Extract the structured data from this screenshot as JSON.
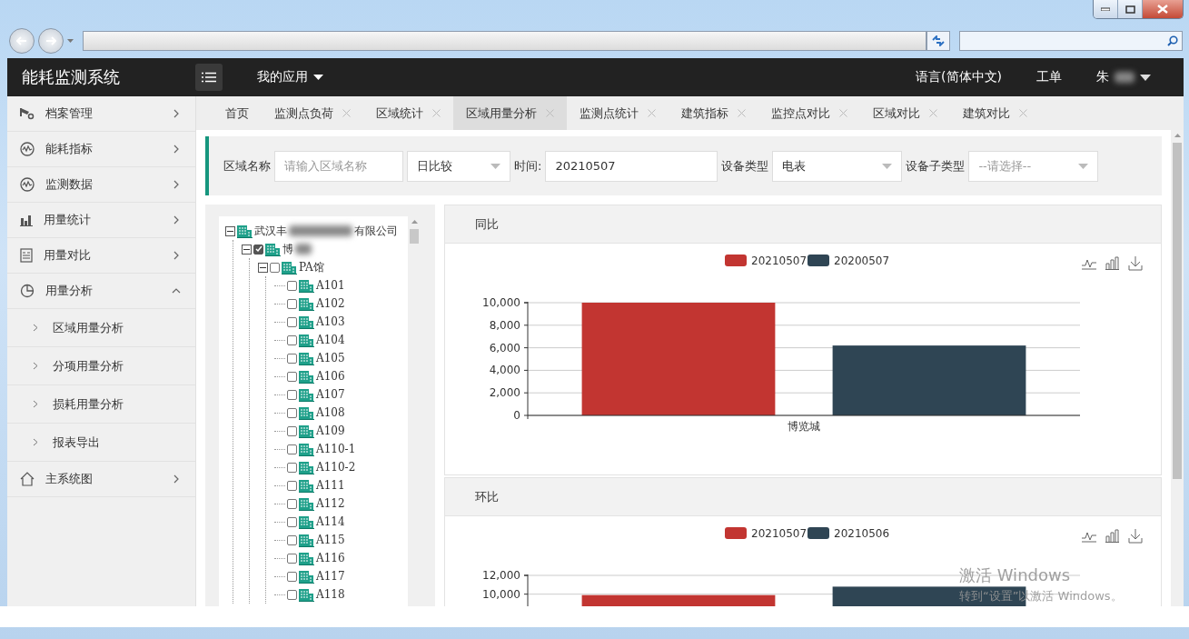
{
  "header": {
    "title": "能耗监测系统",
    "menu": "我的应用",
    "language": "语言(简体中文)",
    "work_order": "工单",
    "user": {
      "name": "朱",
      "redacted": true
    }
  },
  "sidebar": [
    {
      "label": "档案管理",
      "expanded": false
    },
    {
      "label": "能耗指标",
      "expanded": false
    },
    {
      "label": "监测数据",
      "expanded": false
    },
    {
      "label": "用量统计",
      "expanded": false
    },
    {
      "label": "用量对比",
      "expanded": false
    },
    {
      "label": "用量分析",
      "expanded": true,
      "children": [
        "区域用量分析",
        "分项用量分析",
        "损耗用量分析",
        "报表导出"
      ]
    },
    {
      "label": "主系统图",
      "expanded": false
    }
  ],
  "tabs": [
    {
      "label": "首页",
      "selected": false,
      "closable": false
    },
    {
      "label": "监测点负荷",
      "selected": false,
      "closable": true
    },
    {
      "label": "区域统计",
      "selected": false,
      "closable": true
    },
    {
      "label": "区域用量分析",
      "selected": true,
      "closable": true
    },
    {
      "label": "监测点统计",
      "selected": false,
      "closable": true
    },
    {
      "label": "建筑指标",
      "selected": false,
      "closable": true
    },
    {
      "label": "监控点对比",
      "selected": false,
      "closable": true
    },
    {
      "label": "区域对比",
      "selected": false,
      "closable": true
    },
    {
      "label": "建筑对比",
      "selected": false,
      "closable": true
    }
  ],
  "filters": [
    {
      "kind": "label",
      "text": "区域名称"
    },
    {
      "kind": "input",
      "placeholder": "请输入区域名称"
    },
    {
      "kind": "select",
      "value": "日比较"
    },
    {
      "kind": "label",
      "text": "时间:"
    },
    {
      "kind": "input",
      "value": "20210507"
    },
    {
      "kind": "label",
      "text": "设备类型"
    },
    {
      "kind": "select",
      "value": "电表"
    },
    {
      "kind": "label",
      "text": "设备子类型"
    },
    {
      "kind": "select",
      "placeholder": "--请选择--"
    }
  ],
  "tree": {
    "label": "武汉丰",
    "label_end": "有限公司",
    "redacted": true,
    "expanded": true,
    "children": [
      {
        "label": "博",
        "redacted": true,
        "checked": true,
        "expanded": true,
        "children": [
          {
            "label": "PA馆",
            "checked": false,
            "expanded": true,
            "children": [
              {
                "label": "A101",
                "checked": false
              },
              {
                "label": "A102",
                "checked": false
              },
              {
                "label": "A103",
                "checked": false
              },
              {
                "label": "A104",
                "checked": false
              },
              {
                "label": "A105",
                "checked": false
              },
              {
                "label": "A106",
                "checked": false
              },
              {
                "label": "A107",
                "checked": false
              },
              {
                "label": "A108",
                "checked": false
              },
              {
                "label": "A109",
                "checked": false
              },
              {
                "label": "A110-1",
                "checked": false
              },
              {
                "label": "A110-2",
                "checked": false
              },
              {
                "label": "A111",
                "checked": false
              },
              {
                "label": "A112",
                "checked": false
              },
              {
                "label": "A114",
                "checked": false
              },
              {
                "label": "A115",
                "checked": false
              },
              {
                "label": "A116",
                "checked": false
              },
              {
                "label": "A117",
                "checked": false
              },
              {
                "label": "A118",
                "checked": false
              }
            ]
          }
        ]
      }
    ]
  },
  "charts": [
    {
      "title": "同比",
      "chart_data": {
        "type": "bar",
        "categories": [
          "博览城"
        ],
        "series": [
          {
            "name": "20210507",
            "color": "#c23531",
            "values": [
              10000
            ]
          },
          {
            "name": "20200507",
            "color": "#2f4554",
            "values": [
              6200
            ]
          }
        ],
        "ylim": [
          0,
          10000
        ],
        "yticks": [
          {
            "value": 0,
            "label": "0"
          },
          {
            "value": 2000,
            "label": "2,000"
          },
          {
            "value": 4000,
            "label": "4,000"
          },
          {
            "value": 6000,
            "label": "6,000"
          },
          {
            "value": 8000,
            "label": "8,000"
          },
          {
            "value": 10000,
            "label": "10,000"
          }
        ],
        "grid": true,
        "legend": "top"
      }
    },
    {
      "title": "环比",
      "chart_data": {
        "type": "bar",
        "series": [
          {
            "name": "20210507",
            "color": "#c23531",
            "values": [
              9900
            ]
          },
          {
            "name": "20210506",
            "color": "#2f4554",
            "values": [
              10800
            ]
          }
        ],
        "ylim": [
          0,
          12000
        ],
        "yticks": [
          {
            "value": 10000,
            "label": "10,000"
          },
          {
            "value": 12000,
            "label": "12,000"
          }
        ],
        "grid": true,
        "legend": "top"
      }
    }
  ],
  "os_watermark": {
    "title": "激活 Windows",
    "subtitle": "转到“设置”以激活 Windows。"
  }
}
